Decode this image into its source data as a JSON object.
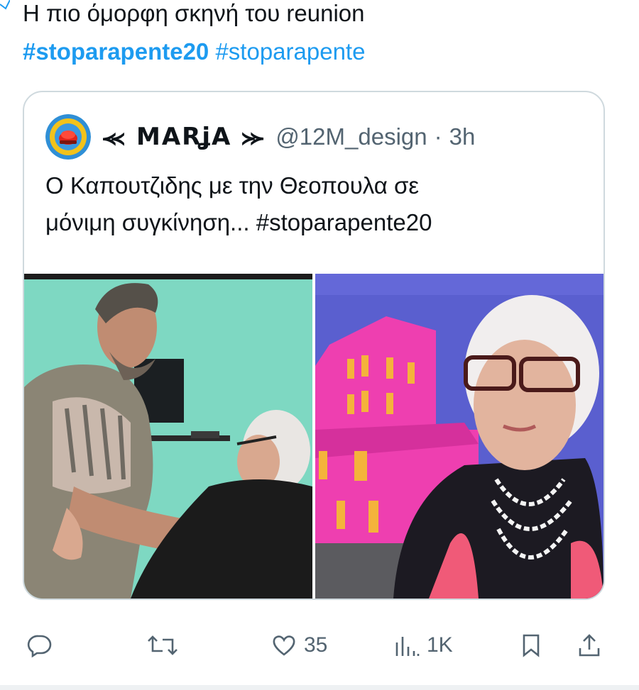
{
  "tweet": {
    "text": "Η πιο όμορφη σκηνή του reunion",
    "hashtags": [
      "#stoparapente20",
      "#stoparapente"
    ]
  },
  "quoted_tweet": {
    "display_name": "⪻ MARʝA ⪼",
    "handle": "@12M_design",
    "separator": "·",
    "time": "3h",
    "text_line1": "Ο Καπουτζιδης με την Θεοπουλα σε",
    "text_line2": "μόνιμη συγκίνηση... #stoparapente20",
    "media": [
      {
        "icon": "photo-man-hugging-woman"
      },
      {
        "icon": "photo-elderly-woman-pink-backdrop"
      }
    ]
  },
  "actions": {
    "reply": {
      "icon": "reply-icon"
    },
    "retweet": {
      "icon": "retweet-icon"
    },
    "like": {
      "icon": "heart-icon",
      "count": "35"
    },
    "views": {
      "icon": "views-icon",
      "count": "1K"
    },
    "bookmark": {
      "icon": "bookmark-icon"
    },
    "share": {
      "icon": "share-icon"
    }
  },
  "colors": {
    "hashtag": "#1d9bf0",
    "secondary_text": "#536471",
    "card_border": "#cfd9de"
  }
}
